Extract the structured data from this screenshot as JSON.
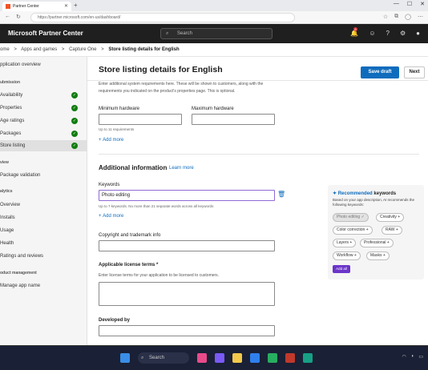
{
  "browser": {
    "tab_title": "Partner Center",
    "url": "https://partner.microsoft.com/en-us/dashboard/"
  },
  "appbar": {
    "brand": "Microsoft Partner Center",
    "search_placeholder": "Search",
    "notification_count": "6"
  },
  "breadcrumb": {
    "home": "ome",
    "apps": "Apps and games",
    "product": "Capture One",
    "current": "Store listing details for English",
    "sep": ">"
  },
  "sidebar": {
    "app_overview": "pplication overview",
    "submission_head": "ubmission",
    "items": [
      {
        "label": "Availability",
        "done": true
      },
      {
        "label": "Properties",
        "done": true
      },
      {
        "label": "Age ratings",
        "done": true
      },
      {
        "label": "Packages",
        "done": true
      },
      {
        "label": "Store listing",
        "done": true
      }
    ],
    "review_head": "view",
    "package_validation": "Package validation",
    "analytics_head": "alytics",
    "analytics_items": [
      "Overview",
      "Installs",
      "Usage",
      "Health",
      "Ratings and reviews"
    ],
    "product_head": "oduct management",
    "manage_app_name": "Manage app name"
  },
  "page": {
    "title": "Store listing details for English",
    "save_draft": "Save draft",
    "next": "Next",
    "req_text_1": "Enter additional system requirements here. These will be shown to customers, along with the",
    "req_text_2": "requirements you indicated on the product's properties page. This is optional.",
    "min_hw": "Minimum hardware",
    "max_hw": "Maximum hardware",
    "req_hint": "Up to 11 requirements",
    "add_more": "Add more",
    "additional_info": "Additional information",
    "learn_more": "Learn more",
    "keywords_label": "Keywords",
    "keywords_value": "Photo editing",
    "keywords_hint": "Up to 7 keywords.  No more than 21 separate words across all keywords",
    "copyright_label": "Copyright and trademark info",
    "license_label": "Applicable license terms",
    "license_required": "*",
    "license_hint": "Enter license terms for your application to be licensed to customers.",
    "developed_by": "Developed by"
  },
  "recommend": {
    "title_prefix": "Recommended",
    "title_suffix": "keywords",
    "desc": "Based on your app description, AI recommends the following keywords:",
    "chips": [
      "Photo editing",
      "Creativity",
      "Color correction",
      "RAW",
      "Layers",
      "Professional",
      "Workflow",
      "Masks"
    ],
    "add_all": "Add all"
  },
  "taskbar": {
    "search": "Search"
  },
  "colors": {
    "accent": "#0f6cbd",
    "success": "#107c10",
    "copilot": "#6b35c9"
  }
}
